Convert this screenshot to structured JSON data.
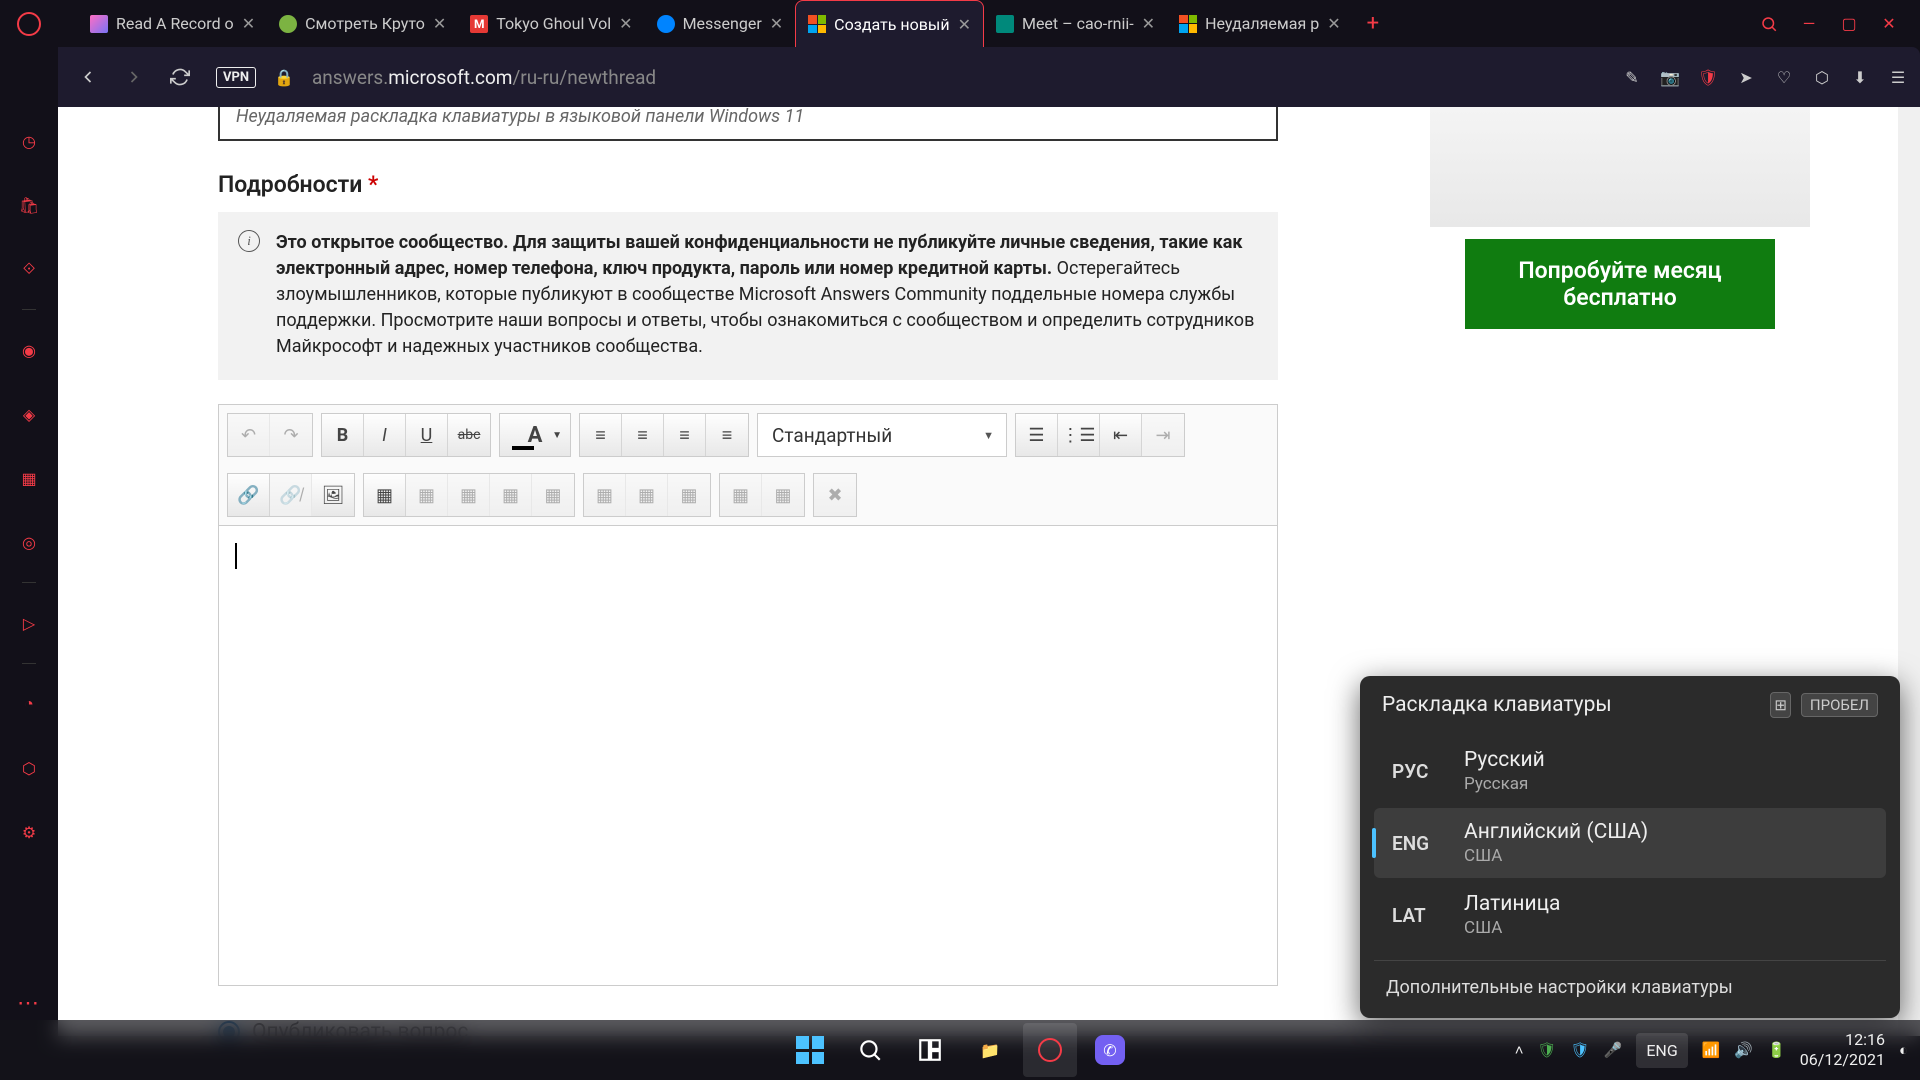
{
  "browser": {
    "tabs": [
      {
        "label": "Read A Record o",
        "icon_color": "#8a2be2"
      },
      {
        "label": "Смотреть Круто",
        "icon_color": "#7cb342"
      },
      {
        "label": "Tokyo Ghoul Vol",
        "icon_color": "#e53935"
      },
      {
        "label": "Messenger",
        "icon_color": "#0084ff"
      },
      {
        "label": "Создать новый",
        "icon": "ms",
        "active": true
      },
      {
        "label": "Meet – cao-rnii-",
        "icon_color": "#00897b"
      },
      {
        "label": "Неудаляемая р",
        "icon": "ms"
      }
    ],
    "url_prefix": "answers.",
    "url_bold": "microsoft.com",
    "url_suffix": "/ru-ru/newthread",
    "vpn": "VPN"
  },
  "page": {
    "title_input": "Неудаляемая раскладка клавиатуры в языковой панели Windows 11",
    "details_label": "Подробности",
    "notice_bold": "Это открытое сообщество. Для защиты вашей конфиденциальности не публикуйте личные сведения, такие как электронный адрес, номер телефона, ключ продукта, пароль или номер кредитной карты.",
    "notice_rest": "Остерегайтесь злоумышленников, которые публикуют в сообществе Microsoft Answers Community поддельные номера службы поддержки.  Просмотрите наши вопросы и ответы, чтобы ознакомиться с сообществом и определить сотрудников Майкрософт и надежных участников сообщества.",
    "format_select": "Стандартный",
    "publish_label": "Опубликовать вопрос"
  },
  "promo": {
    "cta": "Попробуйте месяц бесплатно"
  },
  "lang_popup": {
    "title": "Раскладка клавиатуры",
    "space_key": "ПРОБЕЛ",
    "items": [
      {
        "code": "РУС",
        "name": "Русский",
        "sub": "Русская"
      },
      {
        "code": "ENG",
        "name": "Английский (США)",
        "sub": "США",
        "active": true
      },
      {
        "code": "LAT",
        "name": "Латиница",
        "sub": "США"
      }
    ],
    "footer": "Дополнительные настройки клавиатуры"
  },
  "taskbar": {
    "lang": "ENG",
    "time": "12:16",
    "date": "06/12/2021"
  }
}
